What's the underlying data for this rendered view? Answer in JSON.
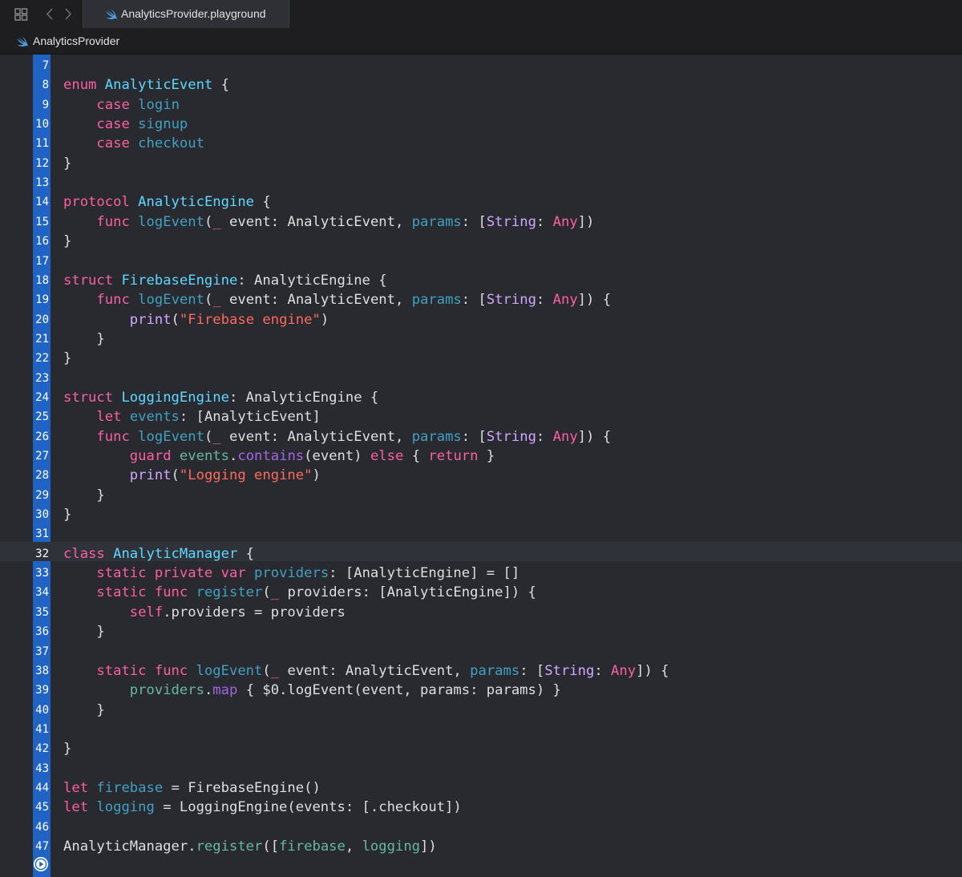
{
  "tab": {
    "title": "AnalyticsProvider.playground"
  },
  "jumpbar": {
    "path": "AnalyticsProvider"
  },
  "colors": {
    "keyword": "#fc5fa3",
    "type_decl": "#5dd8ff",
    "other_decl": "#41a1c0",
    "other_ref": "#67b7a4",
    "type_ref": "#d0a8ff",
    "other_type_name": "#a167e6",
    "string": "#fc6a5d",
    "plain": "#dfdfe0",
    "line_number_bar": "#1f63c4"
  },
  "editor": {
    "current_line": 32,
    "lines": [
      {
        "n": "7",
        "tokens": []
      },
      {
        "n": "8",
        "tokens": [
          [
            "kw",
            "enum"
          ],
          [
            "pl",
            " "
          ],
          [
            "td",
            "AnalyticEvent"
          ],
          [
            "pl",
            " {"
          ]
        ]
      },
      {
        "n": "9",
        "tokens": [
          [
            "pl",
            "    "
          ],
          [
            "kw",
            "case"
          ],
          [
            "pl",
            " "
          ],
          [
            "od",
            "login"
          ]
        ]
      },
      {
        "n": "10",
        "tokens": [
          [
            "pl",
            "    "
          ],
          [
            "kw",
            "case"
          ],
          [
            "pl",
            " "
          ],
          [
            "od",
            "signup"
          ]
        ]
      },
      {
        "n": "11",
        "tokens": [
          [
            "pl",
            "    "
          ],
          [
            "kw",
            "case"
          ],
          [
            "pl",
            " "
          ],
          [
            "od",
            "checkout"
          ]
        ]
      },
      {
        "n": "12",
        "tokens": [
          [
            "pl",
            "}"
          ]
        ]
      },
      {
        "n": "13",
        "tokens": []
      },
      {
        "n": "14",
        "tokens": [
          [
            "kw",
            "protocol"
          ],
          [
            "pl",
            " "
          ],
          [
            "td",
            "AnalyticEngine"
          ],
          [
            "pl",
            " {"
          ]
        ]
      },
      {
        "n": "15",
        "tokens": [
          [
            "pl",
            "    "
          ],
          [
            "kw",
            "func"
          ],
          [
            "pl",
            " "
          ],
          [
            "od",
            "logEvent"
          ],
          [
            "pl",
            "("
          ],
          [
            "kw",
            "_"
          ],
          [
            "pl",
            " event: AnalyticEvent, "
          ],
          [
            "od",
            "params"
          ],
          [
            "pl",
            ": ["
          ],
          [
            "tr",
            "String"
          ],
          [
            "pl",
            ": "
          ],
          [
            "kw",
            "Any"
          ],
          [
            "pl",
            "])"
          ]
        ]
      },
      {
        "n": "16",
        "tokens": [
          [
            "pl",
            "}"
          ]
        ]
      },
      {
        "n": "17",
        "tokens": []
      },
      {
        "n": "18",
        "tokens": [
          [
            "kw",
            "struct"
          ],
          [
            "pl",
            " "
          ],
          [
            "td",
            "FirebaseEngine"
          ],
          [
            "pl",
            ": AnalyticEngine {"
          ]
        ]
      },
      {
        "n": "19",
        "tokens": [
          [
            "pl",
            "    "
          ],
          [
            "kw",
            "func"
          ],
          [
            "pl",
            " "
          ],
          [
            "od",
            "logEvent"
          ],
          [
            "pl",
            "("
          ],
          [
            "kw",
            "_"
          ],
          [
            "pl",
            " event: AnalyticEvent, "
          ],
          [
            "od",
            "params"
          ],
          [
            "pl",
            ": ["
          ],
          [
            "tr",
            "String"
          ],
          [
            "pl",
            ": "
          ],
          [
            "kw",
            "Any"
          ],
          [
            "pl",
            "]) {"
          ]
        ]
      },
      {
        "n": "20",
        "tokens": [
          [
            "pl",
            "        "
          ],
          [
            "tr",
            "print"
          ],
          [
            "pl",
            "("
          ],
          [
            "st",
            "\"Firebase engine\""
          ],
          [
            "pl",
            ")"
          ]
        ]
      },
      {
        "n": "21",
        "tokens": [
          [
            "pl",
            "    }"
          ]
        ]
      },
      {
        "n": "22",
        "tokens": [
          [
            "pl",
            "}"
          ]
        ]
      },
      {
        "n": "23",
        "tokens": []
      },
      {
        "n": "24",
        "tokens": [
          [
            "kw",
            "struct"
          ],
          [
            "pl",
            " "
          ],
          [
            "td",
            "LoggingEngine"
          ],
          [
            "pl",
            ": AnalyticEngine {"
          ]
        ]
      },
      {
        "n": "25",
        "tokens": [
          [
            "pl",
            "    "
          ],
          [
            "kw",
            "let"
          ],
          [
            "pl",
            " "
          ],
          [
            "od",
            "events"
          ],
          [
            "pl",
            ": [AnalyticEvent]"
          ]
        ]
      },
      {
        "n": "26",
        "tokens": [
          [
            "pl",
            "    "
          ],
          [
            "kw",
            "func"
          ],
          [
            "pl",
            " "
          ],
          [
            "od",
            "logEvent"
          ],
          [
            "pl",
            "("
          ],
          [
            "kw",
            "_"
          ],
          [
            "pl",
            " event: AnalyticEvent, "
          ],
          [
            "od",
            "params"
          ],
          [
            "pl",
            ": ["
          ],
          [
            "tr",
            "String"
          ],
          [
            "pl",
            ": "
          ],
          [
            "kw",
            "Any"
          ],
          [
            "pl",
            "]) {"
          ]
        ]
      },
      {
        "n": "27",
        "tokens": [
          [
            "pl",
            "        "
          ],
          [
            "kw",
            "guard"
          ],
          [
            "pl",
            " "
          ],
          [
            "or",
            "events"
          ],
          [
            "pl",
            "."
          ],
          [
            "tn",
            "contains"
          ],
          [
            "pl",
            "(event) "
          ],
          [
            "kw",
            "else"
          ],
          [
            "pl",
            " { "
          ],
          [
            "kw",
            "return"
          ],
          [
            "pl",
            " }"
          ]
        ]
      },
      {
        "n": "28",
        "tokens": [
          [
            "pl",
            "        "
          ],
          [
            "tr",
            "print"
          ],
          [
            "pl",
            "("
          ],
          [
            "st",
            "\"Logging engine\""
          ],
          [
            "pl",
            ")"
          ]
        ]
      },
      {
        "n": "29",
        "tokens": [
          [
            "pl",
            "    }"
          ]
        ]
      },
      {
        "n": "30",
        "tokens": [
          [
            "pl",
            "}"
          ]
        ]
      },
      {
        "n": "31",
        "tokens": []
      },
      {
        "n": "32",
        "tokens": [
          [
            "kw",
            "class"
          ],
          [
            "pl",
            " "
          ],
          [
            "td",
            "AnalyticManager"
          ],
          [
            "pl",
            " {"
          ]
        ]
      },
      {
        "n": "33",
        "tokens": [
          [
            "pl",
            "    "
          ],
          [
            "kw",
            "static private var"
          ],
          [
            "pl",
            " "
          ],
          [
            "od",
            "providers"
          ],
          [
            "pl",
            ": [AnalyticEngine] = []"
          ]
        ]
      },
      {
        "n": "34",
        "tokens": [
          [
            "pl",
            "    "
          ],
          [
            "kw",
            "static func"
          ],
          [
            "pl",
            " "
          ],
          [
            "od",
            "register"
          ],
          [
            "pl",
            "("
          ],
          [
            "kw",
            "_"
          ],
          [
            "pl",
            " providers: [AnalyticEngine]) {"
          ]
        ]
      },
      {
        "n": "35",
        "tokens": [
          [
            "pl",
            "        "
          ],
          [
            "kw",
            "self"
          ],
          [
            "pl",
            ".providers = providers"
          ]
        ]
      },
      {
        "n": "36",
        "tokens": [
          [
            "pl",
            "    }"
          ]
        ]
      },
      {
        "n": "37",
        "tokens": []
      },
      {
        "n": "38",
        "tokens": [
          [
            "pl",
            "    "
          ],
          [
            "kw",
            "static func"
          ],
          [
            "pl",
            " "
          ],
          [
            "od",
            "logEvent"
          ],
          [
            "pl",
            "("
          ],
          [
            "kw",
            "_"
          ],
          [
            "pl",
            " event: AnalyticEvent, "
          ],
          [
            "od",
            "params"
          ],
          [
            "pl",
            ": ["
          ],
          [
            "tr",
            "String"
          ],
          [
            "pl",
            ": "
          ],
          [
            "kw",
            "Any"
          ],
          [
            "pl",
            "]) {"
          ]
        ]
      },
      {
        "n": "39",
        "tokens": [
          [
            "pl",
            "        "
          ],
          [
            "or",
            "providers"
          ],
          [
            "pl",
            "."
          ],
          [
            "tn",
            "map"
          ],
          [
            "pl",
            " { $0.logEvent(event, params: params) }"
          ]
        ]
      },
      {
        "n": "40",
        "tokens": [
          [
            "pl",
            "    }"
          ]
        ]
      },
      {
        "n": "41",
        "tokens": []
      },
      {
        "n": "42",
        "tokens": [
          [
            "pl",
            "}"
          ]
        ]
      },
      {
        "n": "43",
        "tokens": []
      },
      {
        "n": "44",
        "tokens": [
          [
            "kw",
            "let"
          ],
          [
            "pl",
            " "
          ],
          [
            "od",
            "firebase"
          ],
          [
            "pl",
            " = FirebaseEngine()"
          ]
        ]
      },
      {
        "n": "45",
        "tokens": [
          [
            "kw",
            "let"
          ],
          [
            "pl",
            " "
          ],
          [
            "od",
            "logging"
          ],
          [
            "pl",
            " = LoggingEngine(events: [.checkout])"
          ]
        ]
      },
      {
        "n": "46",
        "tokens": []
      },
      {
        "n": "47",
        "tokens": [
          [
            "pl",
            "AnalyticManager."
          ],
          [
            "or",
            "register"
          ],
          [
            "pl",
            "(["
          ],
          [
            "or",
            "firebase"
          ],
          [
            "pl",
            ", "
          ],
          [
            "or",
            "logging"
          ],
          [
            "pl",
            "])"
          ]
        ]
      }
    ]
  }
}
